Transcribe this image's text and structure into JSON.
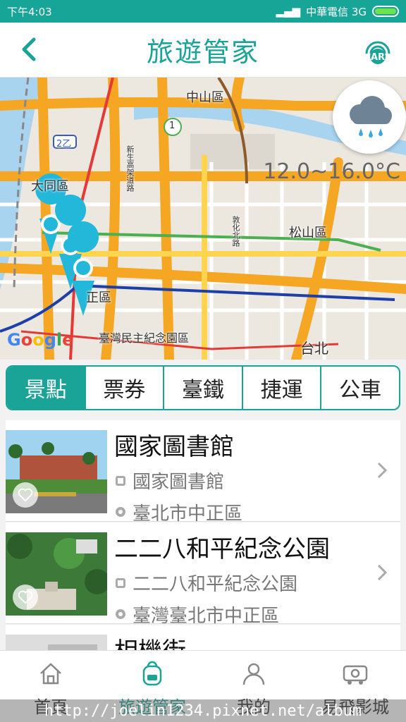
{
  "status_bar": {
    "time": "下午4:03",
    "carrier": "中華電信 3G"
  },
  "header": {
    "title": "旅遊管家",
    "ar_label": "AR"
  },
  "map": {
    "labels": [
      "中山區",
      "大同區",
      "松山區",
      "正區",
      "臺灣民主紀念園區",
      "台北",
      "新生高架道路",
      "敦化北路",
      "2乙",
      "1"
    ],
    "temperature": "12.0~16.0°C",
    "attribution": "Google",
    "weather_icon": "rain-cloud-icon"
  },
  "tabs": [
    {
      "label": "景點",
      "active": true
    },
    {
      "label": "票券",
      "active": false
    },
    {
      "label": "臺鐵",
      "active": false
    },
    {
      "label": "捷運",
      "active": false
    },
    {
      "label": "公車",
      "active": false
    }
  ],
  "attractions": [
    {
      "name": "國家圖書館",
      "subtitle": "國家圖書館",
      "address": "臺北市中正區"
    },
    {
      "name": "二二八和平紀念公園",
      "subtitle": "二二八和平紀念公園",
      "address": "臺灣臺北市中正區"
    },
    {
      "name": "相機街"
    }
  ],
  "bottom_nav": [
    {
      "label": "首頁",
      "icon": "home-icon",
      "active": false
    },
    {
      "label": "旅遊管家",
      "icon": "backpack-icon",
      "active": true
    },
    {
      "label": "我的",
      "icon": "person-icon",
      "active": false
    },
    {
      "label": "易飛影城",
      "icon": "video-icon",
      "active": false
    }
  ],
  "watermark": "http://joelin1234.pixnet.net/album",
  "colors": {
    "accent": "#1aa397",
    "status_bar": "#17a598"
  }
}
